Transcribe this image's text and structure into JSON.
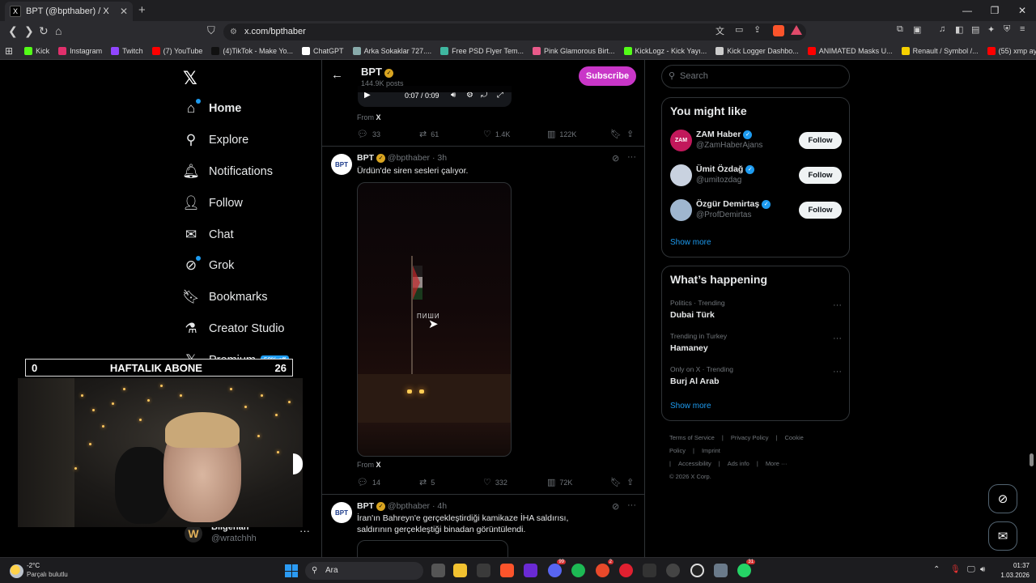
{
  "browser": {
    "tab_title": "BPT (@bpthaber) / X",
    "tab_favicon": "X",
    "new_tab": "+",
    "url": "x.com/bpthaber",
    "bookmarks": [
      {
        "label": "Kick",
        "color": "#53fc18"
      },
      {
        "label": "Instagram",
        "color": "#e1306c"
      },
      {
        "label": "Twitch",
        "color": "#9146ff"
      },
      {
        "label": "(7) YouTube",
        "color": "#ff0000"
      },
      {
        "label": "(4)TikTok - Make Yo...",
        "color": "#111111"
      },
      {
        "label": "ChatGPT",
        "color": "#ffffff"
      },
      {
        "label": "Arka Sokaklar 727....",
        "color": "#8aa"
      },
      {
        "label": "Free PSD Flyer Tem...",
        "color": "#3fb7a0"
      },
      {
        "label": "Pink Glamorous Birt...",
        "color": "#e95a8a"
      },
      {
        "label": "KickLogz - Kick Yayı...",
        "color": "#53fc18"
      },
      {
        "label": "Kick Logger Dashbo...",
        "color": "#cccccc"
      },
      {
        "label": "ANIMATED Masks U...",
        "color": "#ff0000"
      },
      {
        "label": "Renault / Symbol /...",
        "color": "#f5d000"
      },
      {
        "label": "(55) xmp ayarları - Y...",
        "color": "#ff0000"
      }
    ]
  },
  "nav": {
    "items": [
      {
        "label": "Home",
        "icon": "home-icon",
        "glyph": "⌂"
      },
      {
        "label": "Explore",
        "icon": "search-icon",
        "glyph": "⚲"
      },
      {
        "label": "Notifications",
        "icon": "bell-icon",
        "glyph": "🔔︎"
      },
      {
        "label": "Follow",
        "icon": "person-add-icon",
        "glyph": "👤︎"
      },
      {
        "label": "Chat",
        "icon": "mail-icon",
        "glyph": "✉"
      },
      {
        "label": "Grok",
        "icon": "grok-icon",
        "glyph": "⊘"
      },
      {
        "label": "Bookmarks",
        "icon": "bookmark-icon",
        "glyph": "🔖︎"
      },
      {
        "label": "Creator Studio",
        "icon": "flask-icon",
        "glyph": "⚗"
      },
      {
        "label": "Premium",
        "icon": "x-premium-icon",
        "glyph": "𝕏"
      }
    ],
    "premium_badge": "50% off",
    "account": {
      "name": "Bilgehan",
      "handle": "@wratchhh",
      "avatar": "W"
    }
  },
  "stream_overlay": {
    "goal_left": "0",
    "goal_title": "HAFTALIK ABONE",
    "goal_right": "26"
  },
  "profile": {
    "name": "BPT",
    "posts": "144.9K posts",
    "subscribe": "Subscribe"
  },
  "video_controls": {
    "time": "0:07 / 0:09"
  },
  "tweets": [
    {
      "from": "X",
      "replies": "33",
      "reposts": "61",
      "likes": "1.4K",
      "views": "122K"
    },
    {
      "avatar": "BPT",
      "name": "BPT",
      "handle": "@bpthaber",
      "time": "· 3h",
      "text": "Ürdün'de siren sesleri çalıyor.",
      "from": "X",
      "replies": "14",
      "reposts": "5",
      "likes": "332",
      "views": "72K",
      "media_watermark": "ПИШИ"
    },
    {
      "avatar": "BPT",
      "name": "BPT",
      "handle": "@bpthaber",
      "time": "· 4h",
      "text": "İran'ın Bahreyn'e gerçekleştirdiği kamikaze İHA saldırısı, saldırının gerçekleştiği binadan görüntülendi."
    }
  ],
  "sidebar": {
    "search_placeholder": "Search",
    "who_to_follow": {
      "title": "You might like",
      "users": [
        {
          "name": "ZAM Haber",
          "handle": "@ZamHaberAjans",
          "button": "Follow",
          "avatar_color": "#c2185b",
          "avatar_text": "ZAM"
        },
        {
          "name": "Ümit Özdağ",
          "handle": "@umitozdag",
          "button": "Follow",
          "avatar_color": "#c9d2e0",
          "avatar_text": ""
        },
        {
          "name": "Özgür Demirtaş",
          "handle": "@ProfDemirtas",
          "button": "Follow",
          "avatar_color": "#9fb6cf",
          "avatar_text": ""
        }
      ],
      "show_more": "Show more"
    },
    "happening": {
      "title": "What’s happening",
      "trends": [
        {
          "meta": "Politics · Trending",
          "title": "Dubai Türk"
        },
        {
          "meta": "Trending in Turkey",
          "title": "Hamaney"
        },
        {
          "meta": "Only on X · Trending",
          "title": "Burj Al Arab"
        }
      ],
      "show_more": "Show more"
    },
    "footer": [
      "Terms of Service",
      "|",
      "Privacy Policy",
      "|",
      "Cookie Policy",
      "|",
      "Imprint",
      "|",
      "Accessibility",
      "|",
      "Ads info",
      "|",
      "More ···",
      "© 2026 X Corp."
    ]
  },
  "taskbar": {
    "temp": "-2°C",
    "weather": "Parçalı bulutlu",
    "search": "Ara",
    "time": "01:37",
    "date": "1.03.2026",
    "badges": {
      "discord": "99",
      "app2": "2",
      "whatsapp": "31"
    }
  }
}
